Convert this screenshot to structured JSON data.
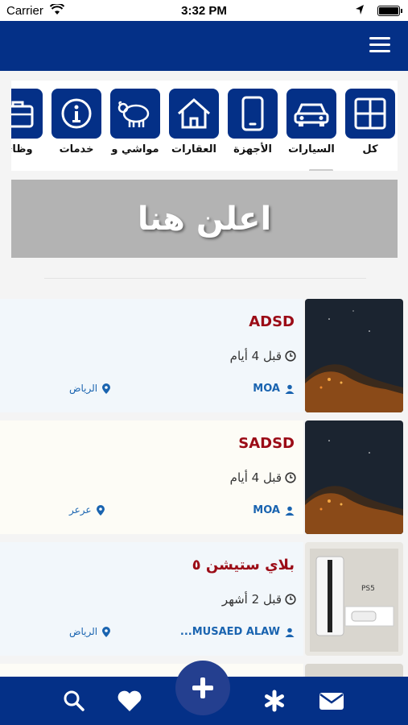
{
  "status": {
    "carrier": "Carrier",
    "time": "3:32 PM"
  },
  "categories": [
    {
      "label": "كل",
      "icon": "grid-icon"
    },
    {
      "label": "السيارات",
      "icon": "car-icon"
    },
    {
      "label": "الأجهزة",
      "icon": "phone-icon"
    },
    {
      "label": "العقارات",
      "icon": "house-icon"
    },
    {
      "label": "مواشي و",
      "icon": "sheep-icon"
    },
    {
      "label": "خدمات",
      "icon": "info-icon"
    },
    {
      "label": "وظائ",
      "icon": "briefcase-icon"
    }
  ],
  "ad_banner": {
    "text": "اعلن هنا"
  },
  "listings": [
    {
      "title": "ADSD",
      "time": "قبل 4 أيام",
      "user": "MOA",
      "city": "الرياض",
      "thumb": "night-coast-image"
    },
    {
      "title": "SADSD",
      "time": "قبل 4 أيام",
      "user": "MOA",
      "city": "عرعر",
      "thumb": "night-coast-image"
    },
    {
      "title": "بلاي ستيشن ٥",
      "time": "قبل 2 أشهر",
      "user": "MUSAED ALAW...",
      "city": "الرياض",
      "thumb": "ps5-box-image"
    }
  ],
  "tabbar": {
    "items": [
      "search-icon",
      "heart-icon",
      "add-icon",
      "asterisk-icon",
      "envelope-icon"
    ]
  },
  "colors": {
    "primary": "#043087",
    "title_red": "#9b0b16",
    "link_blue": "#1a64b0",
    "card_bg_1": "#f2f7fb",
    "card_bg_2": "#fdfcf6"
  }
}
